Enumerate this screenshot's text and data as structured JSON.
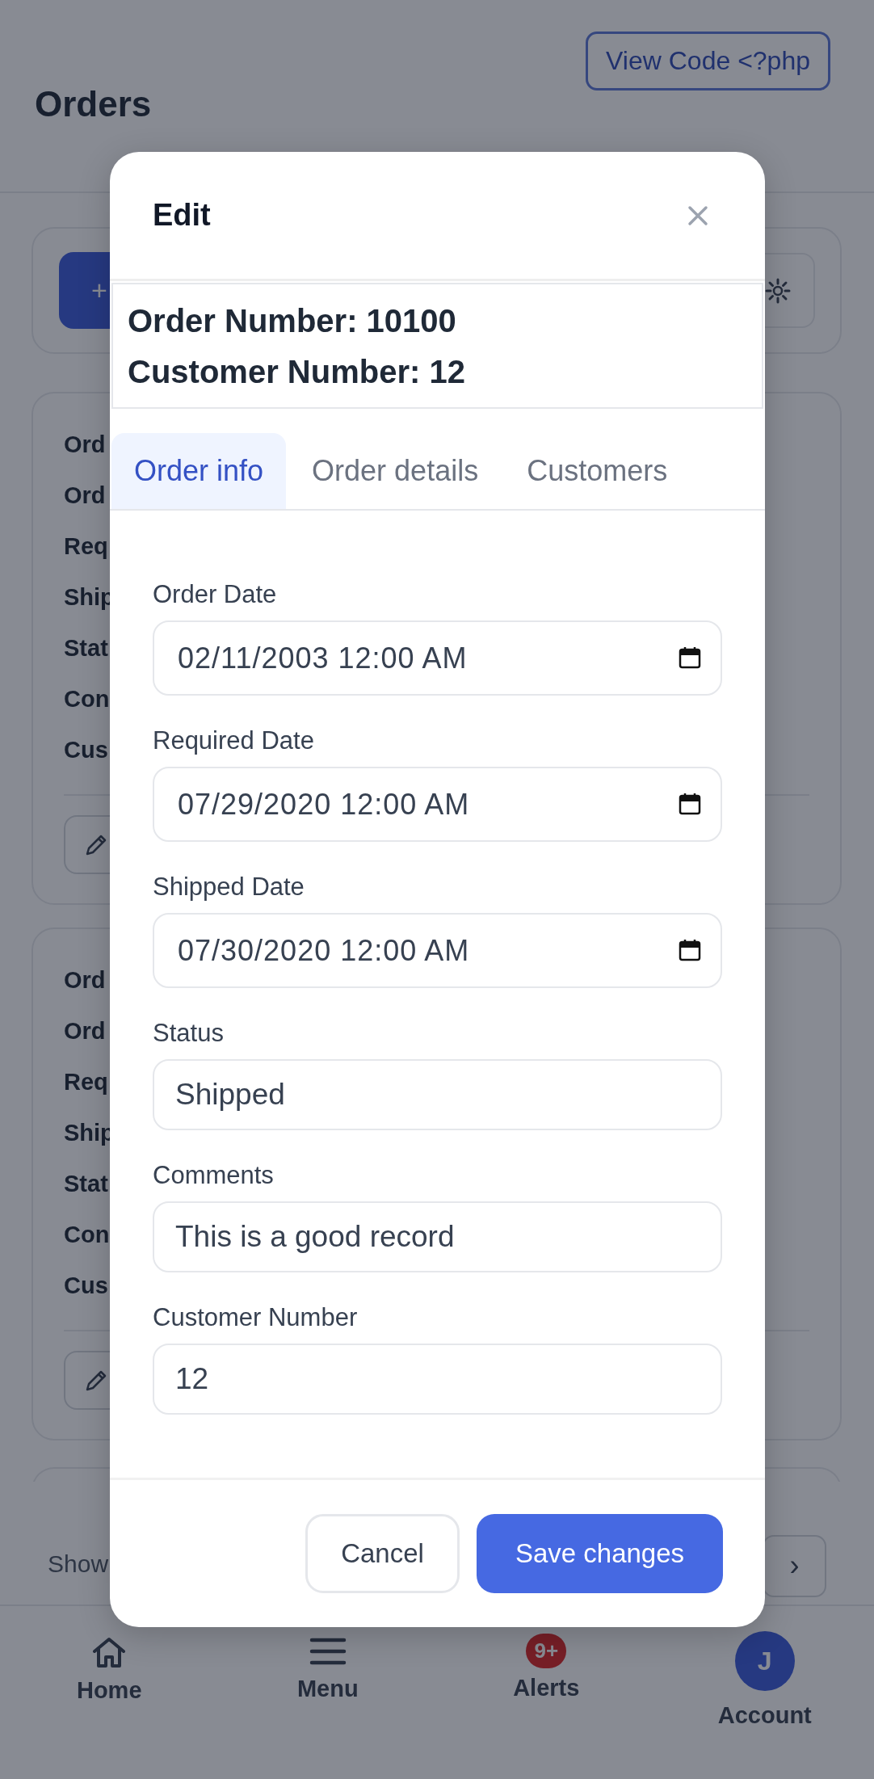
{
  "header": {
    "title": "Orders",
    "view_code_button": "View Code <?php"
  },
  "toolbar": {
    "add_button": "+"
  },
  "records": [
    {
      "labels": [
        "Ord",
        "Ord",
        "Req",
        "Ship",
        "Stat",
        "Con",
        "Cus"
      ]
    },
    {
      "labels": [
        "Ord",
        "Ord",
        "Req",
        "Ship",
        "Stat",
        "Con",
        "Cus"
      ]
    }
  ],
  "pagination": {
    "label": "Show",
    "next_button": "›"
  },
  "modal": {
    "title": "Edit",
    "summary": [
      "Order Number: 10100",
      "Customer Number: 12"
    ],
    "tabs": [
      {
        "label": "Order info",
        "selected": true
      },
      {
        "label": "Order details",
        "selected": false
      },
      {
        "label": "Customers",
        "selected": false
      }
    ],
    "fields": [
      {
        "label": "Order Date",
        "value": "02/11/2003 12:00 AM",
        "kind": "date"
      },
      {
        "label": "Required Date",
        "value": "07/29/2020 12:00 AM",
        "kind": "date"
      },
      {
        "label": "Shipped Date",
        "value": "07/30/2020 12:00 AM",
        "kind": "date"
      },
      {
        "label": "Status",
        "value": "Shipped",
        "kind": "text"
      },
      {
        "label": "Comments",
        "value": "This is a good record",
        "kind": "text"
      },
      {
        "label": "Customer Number",
        "value": "12",
        "kind": "text"
      }
    ],
    "buttons": [
      {
        "label": "Cancel",
        "kind": "secondary"
      },
      {
        "label": "Save changes",
        "kind": "primary"
      }
    ]
  },
  "nav": [
    {
      "label": "Home",
      "kind": "home"
    },
    {
      "label": "Menu",
      "kind": "menu"
    },
    {
      "label": "Alerts",
      "kind": "alerts",
      "badge": "9+"
    },
    {
      "label": "Account",
      "kind": "account",
      "avatar": "J"
    }
  ]
}
